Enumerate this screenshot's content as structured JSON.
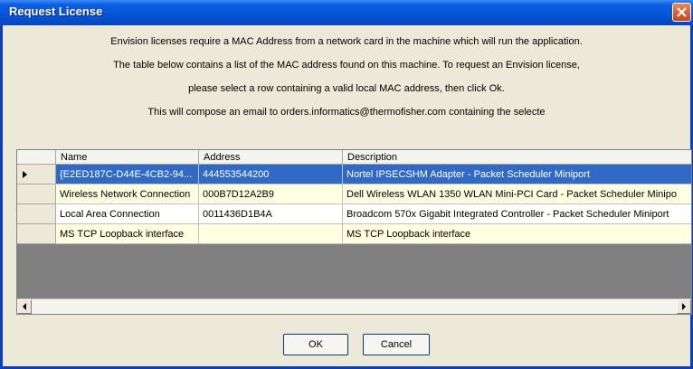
{
  "window": {
    "title": "Request License"
  },
  "message": {
    "line1": "Envision licenses require a MAC Address from a network card in the machine which will run the application.",
    "line2": "The table below contains a list of the MAC address found on this machine.  To request an Envision license,",
    "line3": "please select a row containing a valid local MAC address, then click Ok.",
    "line4": "This will compose an email to orders.informatics@thermofisher.com containing the selecte"
  },
  "table": {
    "columns": [
      "Name",
      "Address",
      "Description"
    ],
    "rows": [
      {
        "name": "{E2ED187C-D44E-4CB2-94...",
        "address": "444553544200",
        "description": "Nortel IPSECSHM Adapter - Packet Scheduler Miniport",
        "selected": true
      },
      {
        "name": "Wireless Network Connection",
        "address": "000B7D12A2B9",
        "description": "Dell Wireless WLAN 1350 WLAN Mini-PCI Card - Packet Scheduler Minipo"
      },
      {
        "name": "Local Area Connection",
        "address": "0011436D1B4A",
        "description": "Broadcom 570x Gigabit Integrated Controller - Packet Scheduler Miniport"
      },
      {
        "name": "MS TCP Loopback interface",
        "address": "",
        "description": "MS TCP Loopback interface"
      }
    ]
  },
  "buttons": {
    "ok": "OK",
    "cancel": "Cancel"
  },
  "icons": {
    "close": "close-icon",
    "row_pointer": "row-pointer-icon",
    "scroll_left": "arrow-left-icon",
    "scroll_right": "arrow-right-icon"
  }
}
